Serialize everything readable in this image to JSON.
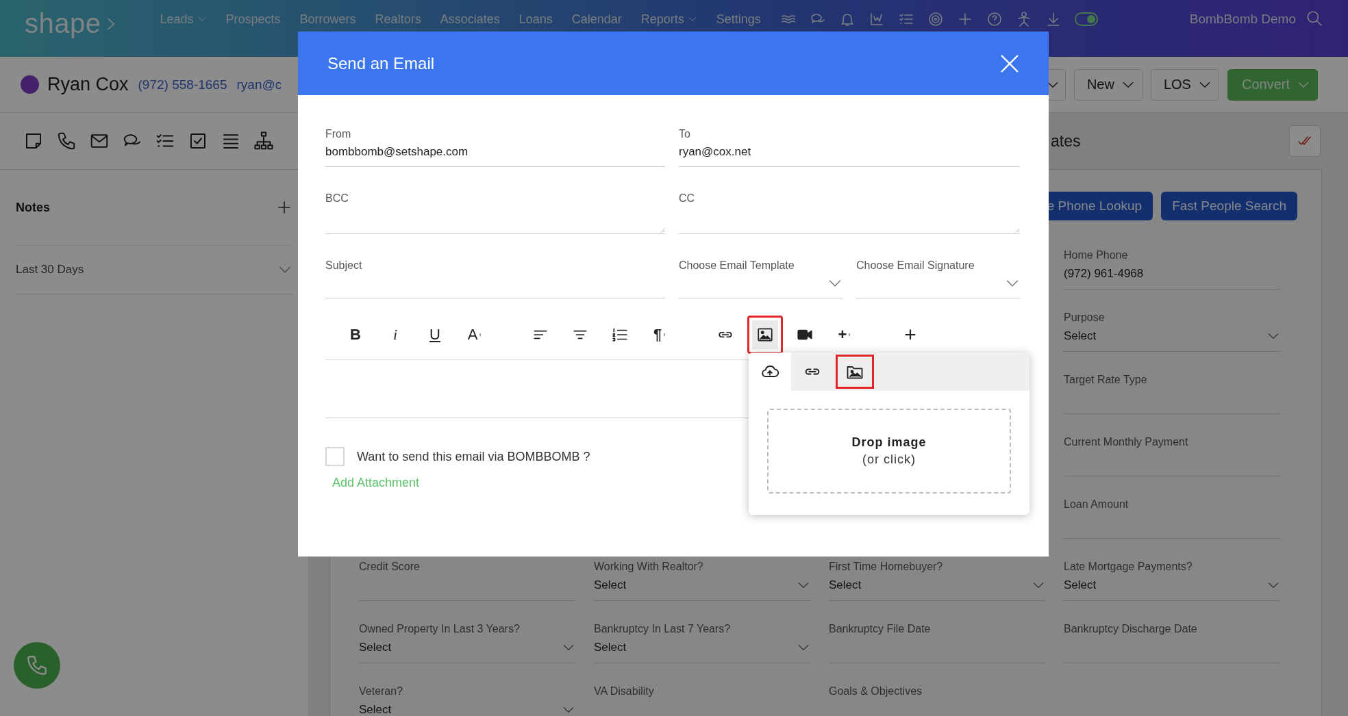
{
  "topbar": {
    "logo": "shape",
    "nav": [
      {
        "label": "Leads",
        "dropdown": true
      },
      {
        "label": "Prospects",
        "dropdown": false
      },
      {
        "label": "Borrowers",
        "dropdown": false
      },
      {
        "label": "Realtors",
        "dropdown": false
      },
      {
        "label": "Associates",
        "dropdown": false
      },
      {
        "label": "Loans",
        "dropdown": false
      },
      {
        "label": "Calendar",
        "dropdown": false
      },
      {
        "label": "Reports",
        "dropdown": true
      },
      {
        "label": "Settings",
        "dropdown": false
      }
    ],
    "icons": [
      {
        "kind": "waves"
      },
      {
        "kind": "chat"
      },
      {
        "kind": "bell"
      },
      {
        "kind": "chart"
      },
      {
        "kind": "checklist"
      },
      {
        "kind": "target"
      },
      {
        "kind": "plus"
      },
      {
        "kind": "help"
      },
      {
        "kind": "person"
      },
      {
        "kind": "download"
      }
    ],
    "toggle": {
      "on": true
    },
    "user": "BombBomb Demo"
  },
  "contact": {
    "name": "Ryan Cox",
    "phone": "(972) 558-1665",
    "email": "ryan@c",
    "actions": [
      {
        "kind": "caret"
      },
      {
        "kind": "dropdown",
        "label": "New"
      },
      {
        "kind": "dropdown",
        "label": "LOS"
      },
      {
        "kind": "primary",
        "label": "Convert"
      }
    ]
  },
  "left_panel": {
    "tools": [
      {
        "kind": "note"
      },
      {
        "kind": "phone"
      },
      {
        "kind": "mail"
      },
      {
        "kind": "chat"
      },
      {
        "kind": "checklist"
      },
      {
        "kind": "task"
      },
      {
        "kind": "lines"
      },
      {
        "kind": "tree"
      }
    ],
    "notes_title": "Notes",
    "filter": "Last 30 Days"
  },
  "main": {
    "section_title": "ates",
    "lookup_buttons": [
      "e Phone Lookup",
      "Fast People Search"
    ],
    "side_fields": [
      {
        "label": "Home Phone",
        "kind": "text",
        "value": "(972) 961-4968"
      },
      {
        "label": "Purpose",
        "kind": "select",
        "value": "Select"
      },
      {
        "label": "Target Rate Type",
        "kind": "text"
      },
      {
        "label": "Current Monthly Payment",
        "kind": "text"
      },
      {
        "label": "Loan Amount",
        "kind": "text"
      }
    ],
    "fields": [
      {
        "label": "Credit Score",
        "kind": "text"
      },
      {
        "label": "Working With Realtor?",
        "kind": "select",
        "value": "Select"
      },
      {
        "label": "First Time Homebuyer?",
        "kind": "select",
        "value": "Select"
      },
      {
        "label": "Late Mortgage Payments?",
        "kind": "select",
        "value": "Select"
      },
      {
        "label": "Owned Property In Last 3 Years?",
        "kind": "select",
        "value": "Select"
      },
      {
        "label": "Bankruptcy In Last 7 Years?",
        "kind": "select",
        "value": "Select"
      },
      {
        "label": "Bankruptcy File Date",
        "kind": "text"
      },
      {
        "label": "Bankruptcy Discharge Date",
        "kind": "text"
      },
      {
        "label": "Veteran?",
        "kind": "select",
        "value": "Select"
      },
      {
        "label": "VA Disability",
        "kind": "text"
      },
      {
        "label": "Goals & Objectives",
        "kind": "text"
      }
    ]
  },
  "modal": {
    "title": "Send an Email",
    "from": {
      "label": "From",
      "value": "bombbomb@setshape.com"
    },
    "to": {
      "label": "To",
      "value": "ryan@cox.net"
    },
    "bcc": {
      "label": "BCC"
    },
    "cc": {
      "label": "CC"
    },
    "subject": {
      "label": "Subject"
    },
    "template": {
      "label": "Choose Email Template"
    },
    "signature": {
      "label": "Choose Email Signature"
    },
    "toolbar": [
      {
        "items": [
          {
            "kind": "bold",
            "label": "B",
            "active": false,
            "highlighted": false
          },
          {
            "kind": "italic",
            "label": "i",
            "active": false,
            "highlighted": false
          },
          {
            "kind": "underline",
            "label": "U",
            "active": false,
            "highlighted": false
          },
          {
            "kind": "font-size",
            "label": "A",
            "active": false,
            "highlighted": false
          }
        ]
      },
      {
        "items": [
          {
            "kind": "align-left",
            "active": false,
            "highlighted": false
          },
          {
            "kind": "align-center",
            "active": false,
            "highlighted": false
          },
          {
            "kind": "ordered-list",
            "active": false,
            "highlighted": false
          },
          {
            "kind": "paragraph",
            "label": "¶",
            "active": false,
            "highlighted": false
          }
        ]
      },
      {
        "items": [
          {
            "kind": "link",
            "active": false,
            "highlighted": false
          },
          {
            "kind": "image",
            "active": true,
            "highlighted": true
          },
          {
            "kind": "video",
            "active": false,
            "highlighted": false
          },
          {
            "kind": "insert",
            "label": "+",
            "active": false,
            "highlighted": false
          }
        ]
      },
      {
        "items": [
          {
            "kind": "add",
            "label": "+",
            "active": false,
            "highlighted": false
          }
        ]
      }
    ],
    "image_popup": {
      "tabs": [
        {
          "kind": "upload",
          "selected": true,
          "highlighted": false
        },
        {
          "kind": "link",
          "selected": false,
          "highlighted": false
        },
        {
          "kind": "gallery",
          "selected": false,
          "highlighted": true
        }
      ],
      "drop_title": "Drop image",
      "drop_hint": "(or click)"
    },
    "bombbomb": {
      "label": "Want to send this email via BOMBBOMB ?",
      "checked": false
    },
    "attachment_link": "Add Attachment"
  }
}
